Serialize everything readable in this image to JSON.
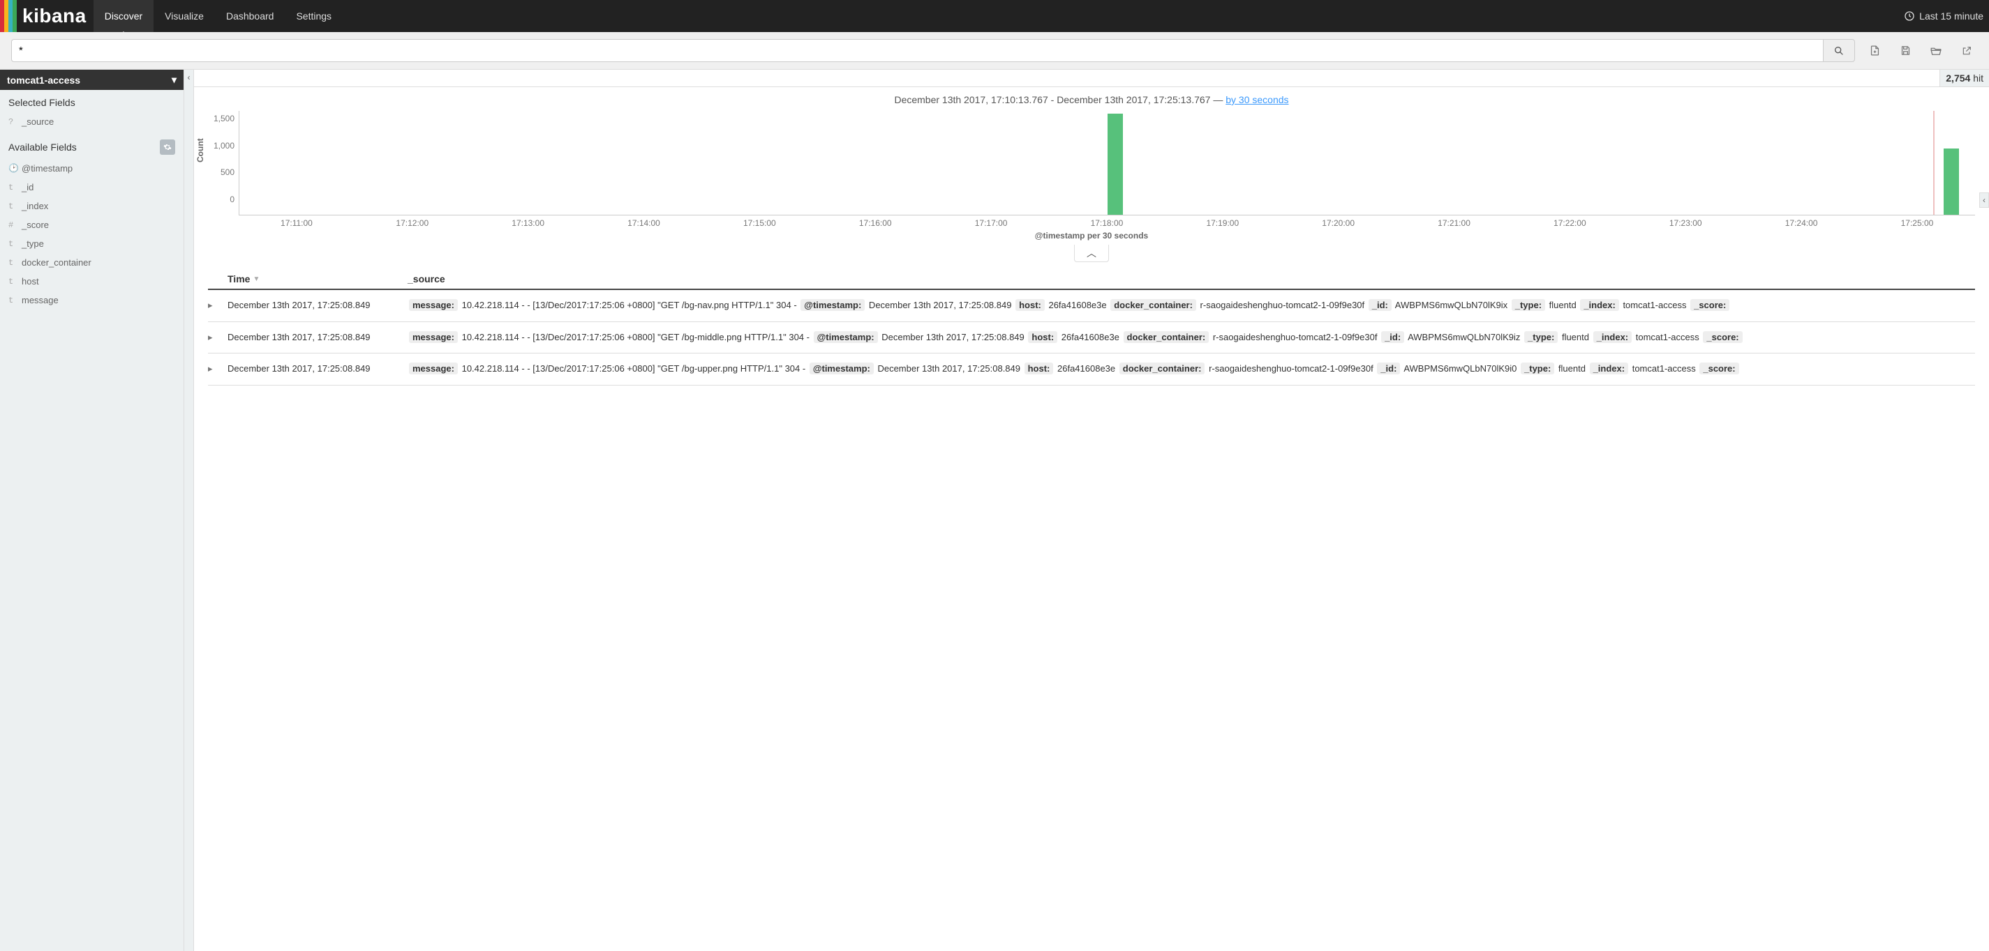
{
  "nav": {
    "logo": "kibana",
    "items": [
      "Discover",
      "Visualize",
      "Dashboard",
      "Settings"
    ],
    "active_index": 0,
    "time_picker": "Last 15 minute"
  },
  "search": {
    "query": "*",
    "placeholder": ""
  },
  "sidebar": {
    "index_pattern": "tomcat1-access",
    "selected_fields_header": "Selected Fields",
    "selected_fields": [
      {
        "type": "?",
        "name": "_source"
      }
    ],
    "available_fields_header": "Available Fields",
    "available_fields": [
      {
        "type": "🕑",
        "name": "@timestamp"
      },
      {
        "type": "t",
        "name": "_id"
      },
      {
        "type": "t",
        "name": "_index"
      },
      {
        "type": "#",
        "name": "_score"
      },
      {
        "type": "t",
        "name": "_type"
      },
      {
        "type": "t",
        "name": "docker_container"
      },
      {
        "type": "t",
        "name": "host"
      },
      {
        "type": "t",
        "name": "message"
      }
    ]
  },
  "hits": {
    "count": "2,754",
    "label": "hit"
  },
  "time_range": {
    "from": "December 13th 2017, 17:10:13.767",
    "to": "December 13th 2017, 17:25:13.767",
    "sep": " - ",
    "dash": " — ",
    "interval_link": "by 30 seconds"
  },
  "chart_data": {
    "type": "bar",
    "ylabel": "Count",
    "xlabel": "@timestamp per 30 seconds",
    "y_ticks": [
      "1,500",
      "1,000",
      "500",
      "0"
    ],
    "ylim": [
      0,
      1700
    ],
    "x_ticks": [
      "17:11:00",
      "17:12:00",
      "17:13:00",
      "17:14:00",
      "17:15:00",
      "17:16:00",
      "17:17:00",
      "17:18:00",
      "17:19:00",
      "17:20:00",
      "17:21:00",
      "17:22:00",
      "17:23:00",
      "17:24:00",
      "17:25:00"
    ],
    "bars": [
      {
        "x_pct": 50.0,
        "value": 1650
      },
      {
        "x_pct": 98.2,
        "value": 1080
      }
    ],
    "marker_x_pct": 97.6
  },
  "table": {
    "headers": {
      "time": "Time",
      "source": "_source"
    },
    "rows": [
      {
        "time": "December 13th 2017, 17:25:08.849",
        "kv": {
          "message": "10.42.218.114 - - [13/Dec/2017:17:25:06 +0800] \"GET /bg-nav.png HTTP/1.1\" 304 -",
          "@timestamp": "December 13th 2017, 17:25:08.849",
          "host": "26fa41608e3e",
          "docker_container": "r-saogaideshenghuo-tomcat2-1-09f9e30f",
          "_id": "AWBPMS6mwQLbN70lK9ix",
          "_type": "fluentd",
          "_index": "tomcat1-access",
          "_score": ""
        }
      },
      {
        "time": "December 13th 2017, 17:25:08.849",
        "kv": {
          "message": "10.42.218.114 - - [13/Dec/2017:17:25:06 +0800] \"GET /bg-middle.png HTTP/1.1\" 304 -",
          "@timestamp": "December 13th 2017, 17:25:08.849",
          "host": "26fa41608e3e",
          "docker_container": "r-saogaideshenghuo-tomcat2-1-09f9e30f",
          "_id": "AWBPMS6mwQLbN70lK9iz",
          "_type": "fluentd",
          "_index": "tomcat1-access",
          "_score": ""
        }
      },
      {
        "time": "December 13th 2017, 17:25:08.849",
        "kv": {
          "message": "10.42.218.114 - - [13/Dec/2017:17:25:06 +0800] \"GET /bg-upper.png HTTP/1.1\" 304 -",
          "@timestamp": "December 13th 2017, 17:25:08.849",
          "host": "26fa41608e3e",
          "docker_container": "r-saogaideshenghuo-tomcat2-1-09f9e30f",
          "_id": "AWBPMS6mwQLbN70lK9i0",
          "_type": "fluentd",
          "_index": "tomcat1-access",
          "_score": ""
        }
      }
    ]
  }
}
